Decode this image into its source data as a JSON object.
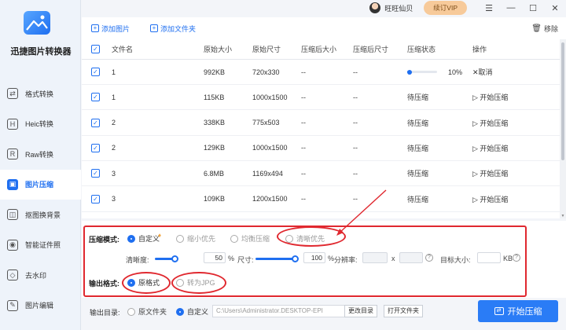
{
  "app": {
    "name": "迅捷图片转换器"
  },
  "titlebar": {
    "username": "旺旺仙贝",
    "vip_label": "续订VIP",
    "menu": "☰",
    "minimize": "—",
    "maximize": "☐",
    "close": "✕"
  },
  "sidebar": {
    "items": [
      {
        "label": "格式转换",
        "icon": "⇄"
      },
      {
        "label": "Heic转换",
        "icon": "H"
      },
      {
        "label": "Raw转换",
        "icon": "R"
      },
      {
        "label": "图片压缩",
        "icon": "▣"
      },
      {
        "label": "抠图换背景",
        "icon": "◫"
      },
      {
        "label": "智能证件照",
        "icon": "◉"
      },
      {
        "label": "去水印",
        "icon": "◇"
      },
      {
        "label": "图片编辑",
        "icon": "✎"
      }
    ],
    "active_index": 3
  },
  "toolbar": {
    "add_image": "添加图片",
    "add_folder": "添加文件夹",
    "remove": "移除"
  },
  "table": {
    "headers": [
      "文件名",
      "原始大小",
      "原始尺寸",
      "压缩后大小",
      "压缩后尺寸",
      "压缩状态",
      "操作"
    ],
    "rows": [
      {
        "name": "1",
        "size": "992KB",
        "dim": "720x330",
        "csize": "--",
        "cdim": "--",
        "status": "10%",
        "progress": 0.1,
        "action": "✕取消"
      },
      {
        "name": "1",
        "size": "115KB",
        "dim": "1000x1500",
        "csize": "--",
        "cdim": "--",
        "status": "待压缩",
        "action": "▷ 开始压缩"
      },
      {
        "name": "2",
        "size": "338KB",
        "dim": "775x503",
        "csize": "--",
        "cdim": "--",
        "status": "待压缩",
        "action": "▷ 开始压缩"
      },
      {
        "name": "2",
        "size": "129KB",
        "dim": "1000x1500",
        "csize": "--",
        "cdim": "--",
        "status": "待压缩",
        "action": "▷ 开始压缩"
      },
      {
        "name": "3",
        "size": "6.8MB",
        "dim": "1169x494",
        "csize": "--",
        "cdim": "--",
        "status": "待压缩",
        "action": "▷ 开始压缩"
      },
      {
        "name": "3",
        "size": "109KB",
        "dim": "1200x1500",
        "csize": "--",
        "cdim": "--",
        "status": "待压缩",
        "action": "▷ 开始压缩"
      }
    ]
  },
  "settings": {
    "mode_label": "压缩模式:",
    "modes": [
      "自定义",
      "缩小优先",
      "均衡压缩",
      "清晰优先"
    ],
    "clarity_label": "清晰度:",
    "clarity_value": "50",
    "percent": "%",
    "size_label": "尺寸:",
    "size_value": "100",
    "resolution_label": "分辨率:",
    "x_label": "x",
    "target_label": "目标大小:",
    "kb_label": "KB",
    "output_format_label": "输出格式:",
    "formats": [
      "原格式",
      "转为JPG"
    ]
  },
  "bottom": {
    "output_dir_label": "输出目录:",
    "original_folder": "原文件夹",
    "custom": "自定义",
    "path": "C:\\Users\\Administrator.DESKTOP-EPI",
    "change_dir": "更改目录",
    "open_folder": "打开文件夹",
    "start": "开始压缩"
  },
  "colors": {
    "accent": "#1f6ff0",
    "annotation": "#e0282f",
    "vip": "#f7ca9a"
  }
}
